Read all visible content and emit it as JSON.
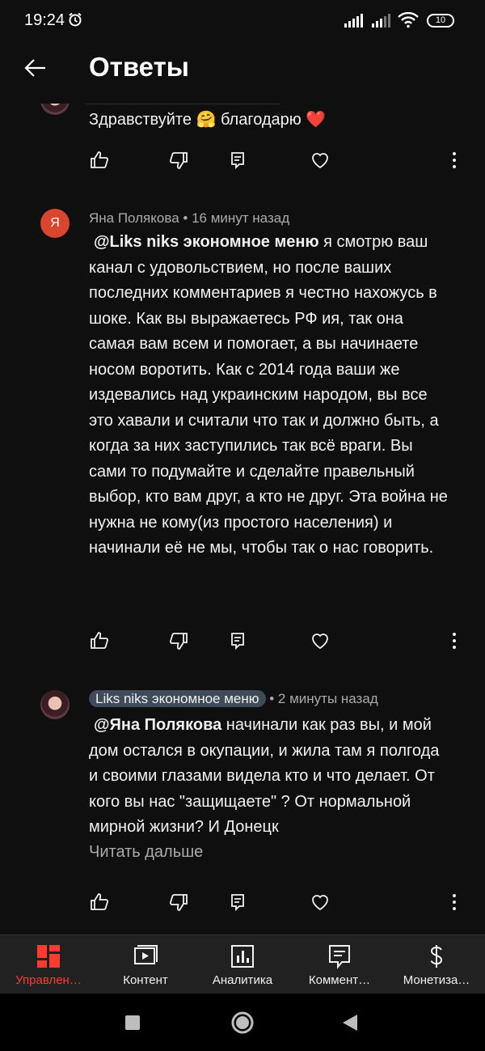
{
  "status_bar": {
    "time": "19:24",
    "battery": "10"
  },
  "header": {
    "title": "Ответы"
  },
  "comments": [
    {
      "text": "Здравствуйте 🤗 благодарю ❤️"
    },
    {
      "author": "Яна Полякова",
      "time": "16 минут назад",
      "avatar_letter": "Я",
      "mention": "@Liks niks экономное меню",
      "text": "  я   смотрю ваш канал с удовольствием, но после ваших последних комментариев я честно нахожусь в шоке. Как вы выражаетесь РФ ия, так она самая вам всем и помогает, а вы начинаете носом воротить. Как с 2014 года ваши же издевались над украинским народом, вы все это хавали и считали что так и должно быть, а когда за них заступились так всё враги. Вы сами то подумайте и сделайте правельный выбор, кто вам друг, а кто не друг. Эта война не нужна не кому(из простого населения) и начинали её не мы, чтобы так о нас говорить."
    },
    {
      "author": "Liks niks экономное меню",
      "time": "2 минуты назад",
      "mention": "@Яна Полякова",
      "text": "  начинали как раз вы, и мой дом остался в окупации, и жила там я полгода и своими глазами видела кто и что делает. От кого вы нас \"защищаете\" ? От нормальной мирной жизни?  И Донецк",
      "read_more": "Читать дальше"
    }
  ],
  "nav": {
    "items": [
      {
        "label": "Управлен…",
        "icon": "dashboard-icon",
        "active": true
      },
      {
        "label": "Контент",
        "icon": "content-icon",
        "active": false
      },
      {
        "label": "Аналитика",
        "icon": "analytics-icon",
        "active": false
      },
      {
        "label": "Коммент…",
        "icon": "comments-icon",
        "active": false
      },
      {
        "label": "Монетиза…",
        "icon": "monetization-icon",
        "active": false
      }
    ]
  },
  "colors": {
    "accent": "#ff3b30",
    "background": "#0f0f0f",
    "chip": "#3f4a5a"
  }
}
